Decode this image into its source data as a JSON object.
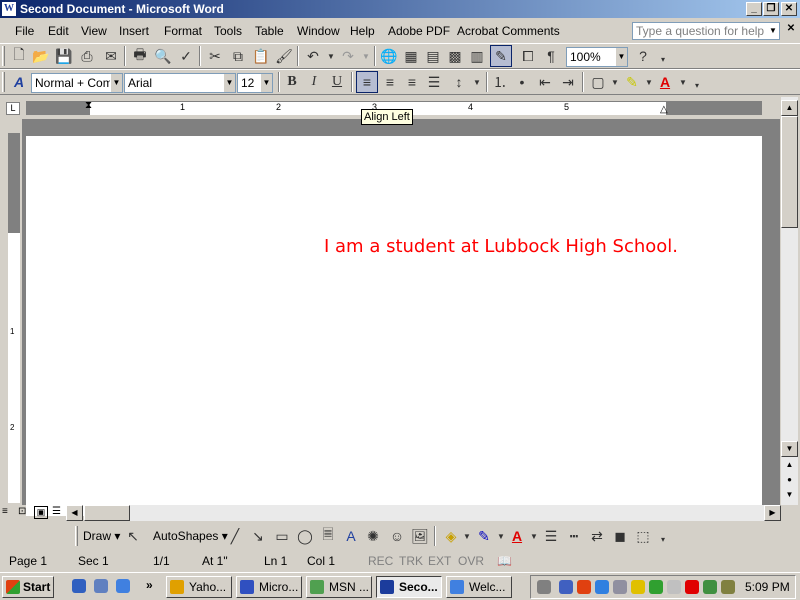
{
  "window": {
    "title": "Second Document - Microsoft Word",
    "icon": "word-icon"
  },
  "menubar": {
    "items": [
      "File",
      "Edit",
      "View",
      "Insert",
      "Format",
      "Tools",
      "Table",
      "Window",
      "Help",
      "Adobe PDF",
      "Acrobat Comments"
    ],
    "help_placeholder": "Type a question for help"
  },
  "toolbar_standard": {
    "zoom": "100%"
  },
  "toolbar_formatting": {
    "style": "Normal + Comic",
    "font": "Arial",
    "size": "12"
  },
  "tooltip": "Align Left",
  "ruler": {
    "numbers": [
      "1",
      "2",
      "3",
      "4",
      "5"
    ]
  },
  "document": {
    "text": "I am a student at Lubbock High School.",
    "text_color": "#ff0000"
  },
  "drawing_toolbar": {
    "draw": "Draw",
    "autoshapes": "AutoShapes"
  },
  "statusbar": {
    "page": "Page  1",
    "sec": "Sec  1",
    "pages": "1/1",
    "at": "At  1\"",
    "ln": "Ln  1",
    "col": "Col  1",
    "rec": "REC",
    "trk": "TRK",
    "ext": "EXT",
    "ovr": "OVR"
  },
  "taskbar": {
    "start": "Start",
    "tasks": [
      "Yaho...",
      "Micro...",
      "MSN ...",
      "Seco...",
      "Welc..."
    ],
    "clock": "5:09 PM"
  }
}
